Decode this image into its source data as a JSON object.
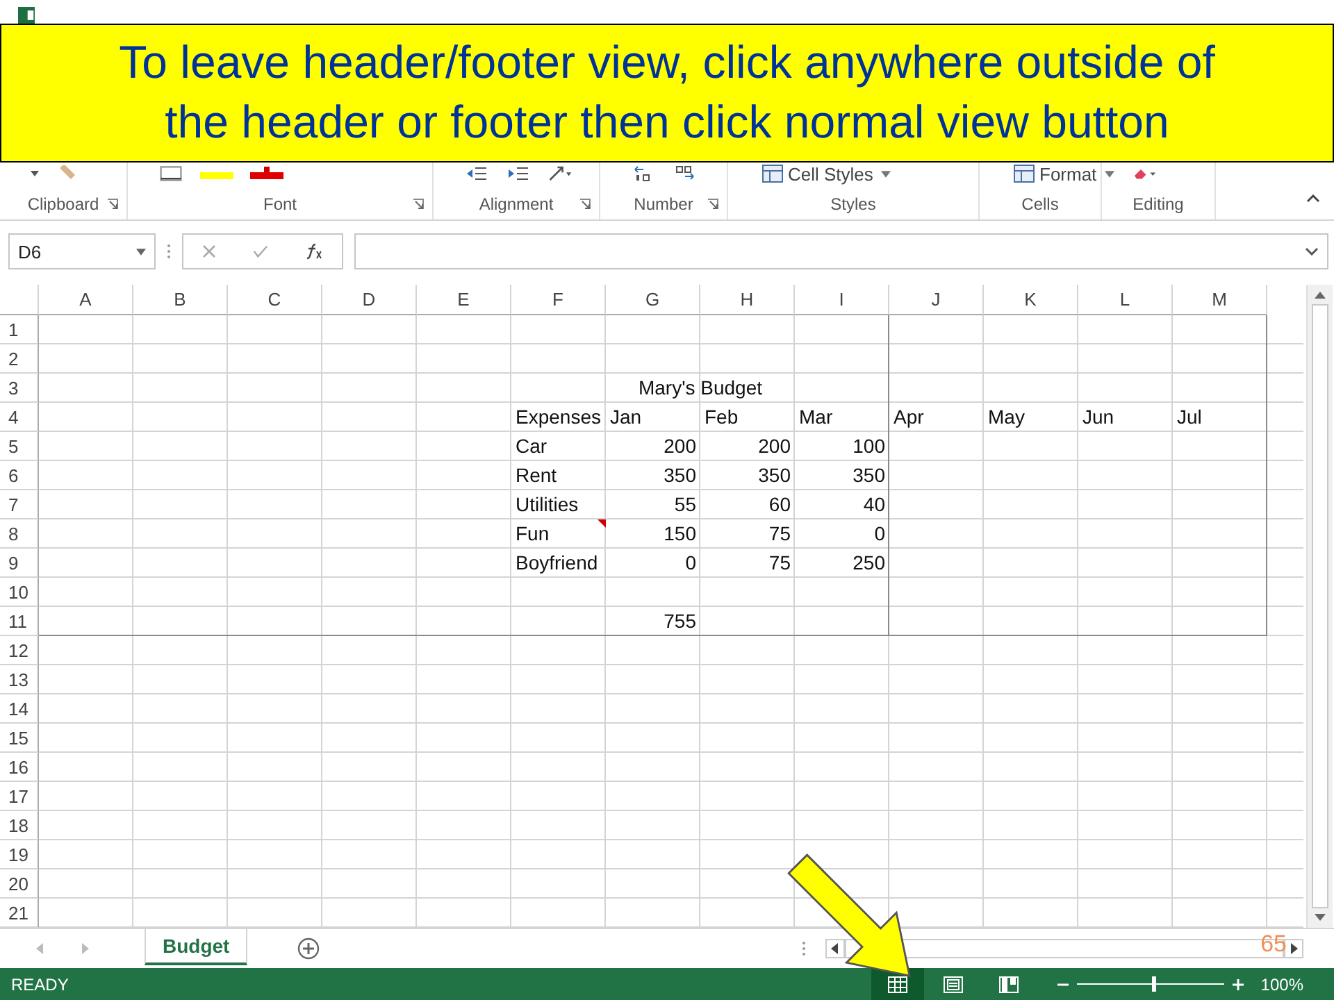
{
  "callout": {
    "lines": [
      "To leave header/footer view, click anywhere outside of",
      "the header or footer then click normal view button"
    ]
  },
  "ribbon": {
    "groups": [
      {
        "label": "Clipboard",
        "launcher": true
      },
      {
        "label": "Font",
        "launcher": true
      },
      {
        "label": "Alignment",
        "launcher": true
      },
      {
        "label": "Number",
        "launcher": true
      },
      {
        "label": "Styles",
        "launcher": false,
        "button": "Cell Styles"
      },
      {
        "label": "Cells",
        "launcher": false,
        "button": "Format"
      },
      {
        "label": "Editing",
        "launcher": false
      }
    ]
  },
  "formula_bar": {
    "name_box": "D6"
  },
  "sheet": {
    "columns": [
      "A",
      "B",
      "C",
      "D",
      "E",
      "F",
      "G",
      "H",
      "I",
      "J",
      "K",
      "L",
      "M"
    ],
    "rows": [
      {
        "header": "1"
      },
      {
        "header": "2"
      },
      {
        "header": "3",
        "merged": "Mary's Budget"
      },
      {
        "header": "4",
        "cells": [
          null,
          null,
          null,
          null,
          null,
          {
            "text": "Expenses",
            "kind": "text"
          },
          {
            "text": "Jan",
            "kind": "text"
          },
          {
            "text": "Feb",
            "kind": "text"
          },
          {
            "text": "Mar",
            "kind": "text"
          },
          {
            "text": "Apr",
            "kind": "text"
          },
          {
            "text": "May",
            "kind": "text"
          },
          {
            "text": "Jun",
            "kind": "text"
          },
          {
            "text": "Jul",
            "kind": "text"
          }
        ]
      },
      {
        "header": "5",
        "cells": [
          null,
          null,
          null,
          null,
          null,
          {
            "text": "Car",
            "kind": "text"
          },
          {
            "text": "200",
            "kind": "number"
          },
          {
            "text": "200",
            "kind": "number"
          },
          {
            "text": "100",
            "kind": "number"
          }
        ]
      },
      {
        "header": "6",
        "cells": [
          null,
          null,
          null,
          null,
          null,
          {
            "text": "Rent",
            "kind": "text"
          },
          {
            "text": "350",
            "kind": "number"
          },
          {
            "text": "350",
            "kind": "number"
          },
          {
            "text": "350",
            "kind": "number"
          }
        ]
      },
      {
        "header": "7",
        "cells": [
          null,
          null,
          null,
          null,
          null,
          {
            "text": "Utilities",
            "kind": "text"
          },
          {
            "text": "55",
            "kind": "number"
          },
          {
            "text": "60",
            "kind": "number"
          },
          {
            "text": "40",
            "kind": "number"
          }
        ]
      },
      {
        "header": "8",
        "cells": [
          null,
          null,
          null,
          null,
          null,
          {
            "text": "Fun",
            "kind": "text",
            "comment": true
          },
          {
            "text": "150",
            "kind": "number"
          },
          {
            "text": "75",
            "kind": "number"
          },
          {
            "text": "0",
            "kind": "number"
          }
        ]
      },
      {
        "header": "9",
        "cells": [
          null,
          null,
          null,
          null,
          null,
          {
            "text": "Boyfriend",
            "kind": "text"
          },
          {
            "text": "0",
            "kind": "number"
          },
          {
            "text": "75",
            "kind": "number"
          },
          {
            "text": "250",
            "kind": "number"
          }
        ]
      },
      {
        "header": "10"
      },
      {
        "header": "11",
        "cells": [
          null,
          null,
          null,
          null,
          null,
          null,
          {
            "text": "755",
            "kind": "number"
          }
        ]
      },
      {
        "header": "12"
      },
      {
        "header": "13"
      },
      {
        "header": "14"
      },
      {
        "header": "15"
      },
      {
        "header": "16"
      },
      {
        "header": "17"
      },
      {
        "header": "18"
      },
      {
        "header": "19"
      },
      {
        "header": "20"
      },
      {
        "header": "21"
      }
    ]
  },
  "sheet_tabs": [
    {
      "label": "Budget",
      "selected": true
    }
  ],
  "slide_number": "65",
  "status_bar": {
    "status": "READY",
    "views": [
      {
        "kind": "normal",
        "selected": true
      },
      {
        "kind": "layout",
        "selected": false
      },
      {
        "kind": "break",
        "selected": false
      }
    ],
    "zoom": {
      "level": 0.52,
      "label": "100%"
    }
  }
}
